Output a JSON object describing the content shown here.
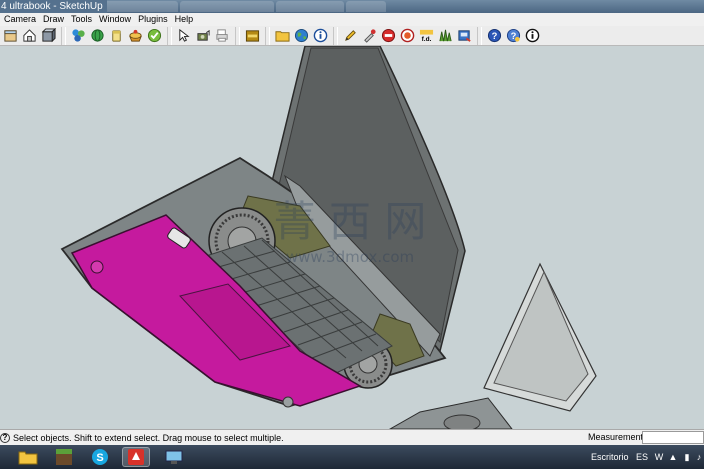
{
  "window": {
    "title": "4 ultrabook - SketchUp",
    "background_tabs": [
      "",
      "",
      ""
    ]
  },
  "menu": {
    "items": [
      "Camera",
      "Draw",
      "Tools",
      "Window",
      "Plugins",
      "Help"
    ]
  },
  "toolbar": {
    "icons": [
      "front-view-icon",
      "home-view-icon",
      "shaded-box-icon",
      "components-icon",
      "globe-icon",
      "paint-bucket-icon",
      "cake-icon",
      "check-icon",
      "select-arrow-icon",
      "camera-icon",
      "print-icon",
      "fire-icon",
      "folder-icon",
      "earth-icon",
      "info-icon",
      "pencil-icon",
      "eyedropper-icon",
      "no-entry-icon",
      "layers-icon",
      "fd-icon",
      "grass-icon",
      "export-icon",
      "help-icon",
      "help-question-icon",
      "about-icon"
    ]
  },
  "canvas": {
    "watermark_cn": "菁 西 网",
    "watermark_url": "www.3dmox.com",
    "colors": {
      "background": "#c8d2d4",
      "laptop_body": "#7c8384",
      "laptop_edge": "#2b2b2b",
      "palmrest": "#c51a9e",
      "screen": "#5c6060",
      "fan": "#7a7c7c",
      "heatsink": "#6e7048"
    }
  },
  "status": {
    "message": "Select objects. Shift to extend select. Drag mouse to select multiple.",
    "measurements_label": "Measurements",
    "measurements_value": ""
  },
  "taskbar": {
    "apps": [
      "file-explorer-icon",
      "minecraft-icon",
      "skype-icon",
      "sketchup-icon",
      "screen-icon"
    ],
    "tray_label": "Escritorio",
    "language": "ES"
  }
}
